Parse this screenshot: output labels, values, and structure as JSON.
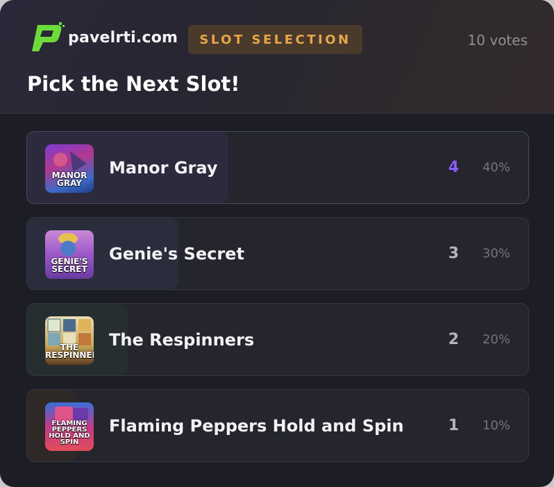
{
  "header": {
    "brand": "pavelrti.com",
    "badge": "SLOT SELECTION",
    "votes": "10 votes",
    "title": "Pick the Next Slot!"
  },
  "accent_color": "#8b5cf6",
  "options": [
    {
      "name": "Manor Gray",
      "votes": "4",
      "percent": "40%",
      "share": 0.4,
      "thumb_caption": "MANOR GRAY"
    },
    {
      "name": "Genie's Secret",
      "votes": "3",
      "percent": "30%",
      "share": 0.3,
      "thumb_caption": "GENIE'S SECRET"
    },
    {
      "name": "The Respinners",
      "votes": "2",
      "percent": "20%",
      "share": 0.2,
      "thumb_caption": "THE RESPINNERS"
    },
    {
      "name": "Flaming Peppers Hold and Spin",
      "votes": "1",
      "percent": "10%",
      "share": 0.1,
      "thumb_caption": "FLAMING PEPPERS HOLD AND SPIN"
    }
  ]
}
